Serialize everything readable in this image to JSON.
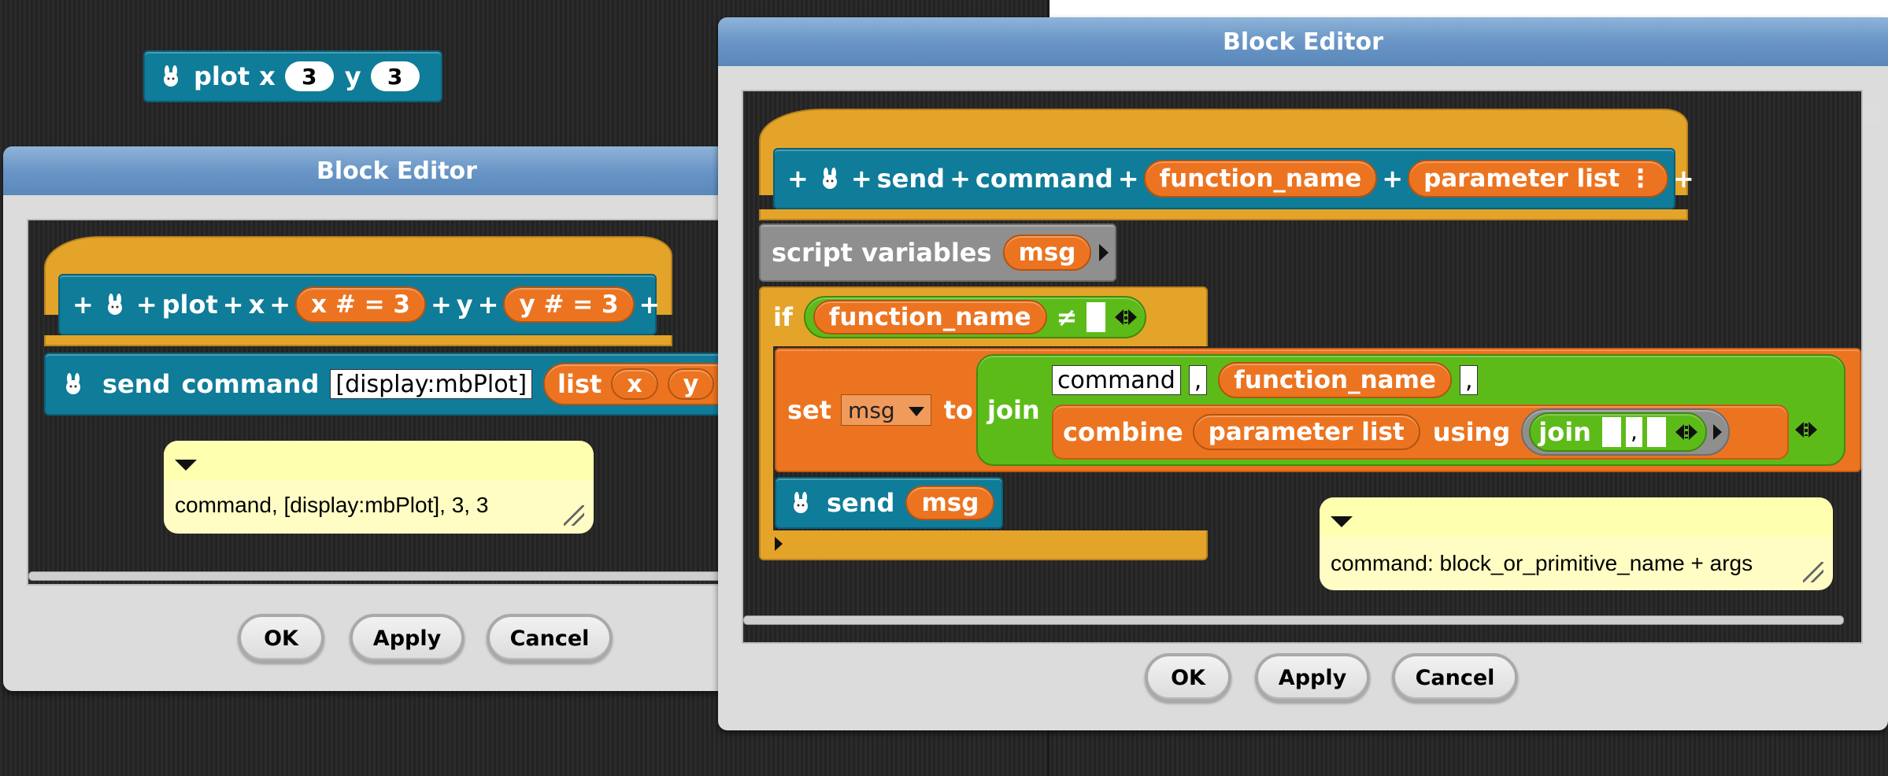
{
  "floating_block": {
    "label_plot": "plot",
    "label_x": "x",
    "val_x": "3",
    "label_y": "y",
    "val_y": "3"
  },
  "editor_left": {
    "title": "Block Editor",
    "hat": {
      "label_plot": "plot",
      "label_x": "x",
      "param_x": "x # = 3",
      "label_y": "y",
      "param_y": "y # = 3"
    },
    "send_block": {
      "label_send": "send",
      "label_command": "command",
      "slot_text": "[display:mbPlot]",
      "list_label": "list",
      "list_item_x": "x",
      "list_item_y": "y"
    },
    "comment": "command, [display:mbPlot], 3, 3",
    "buttons": {
      "ok": "OK",
      "apply": "Apply",
      "cancel": "Cancel"
    }
  },
  "editor_right": {
    "title": "Block Editor",
    "hat": {
      "label_send": "send",
      "label_command": "command",
      "param_function": "function_name",
      "param_list": "parameter list ⋮"
    },
    "script_vars": {
      "label": "script variables",
      "var": "msg"
    },
    "if_block": {
      "label_if": "if",
      "cond_var": "function_name",
      "cond_op": "≠"
    },
    "set_block": {
      "label_set": "set",
      "dropdown": "msg",
      "label_to": "to",
      "label_join": "join",
      "slot_command": "command",
      "slot_comma1": ",",
      "join_function": "function_name",
      "slot_comma2": ",",
      "label_combine": "combine",
      "combine_list": "parameter list",
      "label_using": "using",
      "inner_join": "join",
      "inner_comma": ","
    },
    "send_block": {
      "label_send": "send",
      "var": "msg"
    },
    "comment": "command: block_or_primitive_name + args",
    "buttons": {
      "ok": "OK",
      "apply": "Apply",
      "cancel": "Cancel"
    }
  },
  "colors": {
    "teal": "#0f7c99",
    "orange": "#ec7421",
    "green": "#5dbb19",
    "gold": "#e4a42a",
    "gray": "#8f8f8f",
    "titlebar": "#6996c6"
  }
}
